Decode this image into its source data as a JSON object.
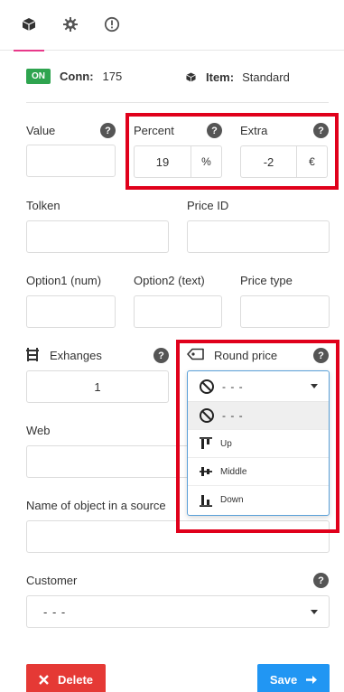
{
  "tabs": [
    {
      "name": "cube-icon",
      "active": true
    },
    {
      "name": "gear-icon",
      "active": false
    },
    {
      "name": "alert-circle-icon",
      "active": false
    }
  ],
  "status": {
    "badge": "ON",
    "conn_label": "Conn:",
    "conn_value": "175",
    "item_label": "Item:",
    "item_value": "Standard"
  },
  "fields": {
    "value": {
      "label": "Value",
      "value": ""
    },
    "percent": {
      "label": "Percent",
      "value": "19",
      "addon": "%"
    },
    "extra": {
      "label": "Extra",
      "value": "-2",
      "addon": "€"
    },
    "tolken": {
      "label": "Tolken",
      "value": ""
    },
    "price_id": {
      "label": "Price ID",
      "value": ""
    },
    "option1": {
      "label": "Option1 (num)",
      "value": ""
    },
    "option2": {
      "label": "Option2 (text)",
      "value": ""
    },
    "price_type": {
      "label": "Price type",
      "value": ""
    },
    "exhanges": {
      "label": "Exhanges",
      "value": "1"
    },
    "round_price": {
      "label": "Round price",
      "selected": "- - -",
      "options": [
        "- - -",
        "Up",
        "Middle",
        "Down"
      ]
    },
    "web": {
      "label": "Web",
      "value": ""
    },
    "object_name": {
      "label": "Name of object in a source",
      "value": ""
    },
    "customer": {
      "label": "Customer",
      "selected": "- - -"
    }
  },
  "help_symbol": "?",
  "buttons": {
    "delete": "Delete",
    "save": "Save"
  },
  "colors": {
    "accent_tab": "#e8398a",
    "badge_green": "#2ea44f",
    "highlight_red": "#e0001b",
    "delete_red": "#e53935",
    "save_blue": "#2196f3"
  }
}
